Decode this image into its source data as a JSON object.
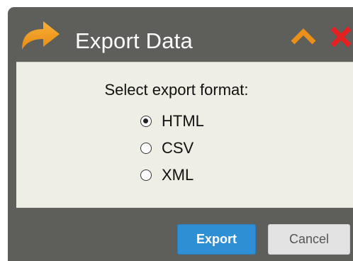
{
  "dialog": {
    "title": "Export Data",
    "icon": "share-arrow-icon",
    "controls": {
      "collapse_icon": "chevron-up-icon",
      "close_icon": "close-icon"
    },
    "accent_colors": {
      "icon_orange": "#f39a1f",
      "close_red": "#e52020",
      "primary_blue": "#2f8fd5"
    }
  },
  "content": {
    "prompt": "Select export format:",
    "options": [
      {
        "label": "HTML",
        "selected": true
      },
      {
        "label": "CSV",
        "selected": false
      },
      {
        "label": "XML",
        "selected": false
      }
    ]
  },
  "buttons": {
    "export_label": "Export",
    "cancel_label": "Cancel"
  }
}
